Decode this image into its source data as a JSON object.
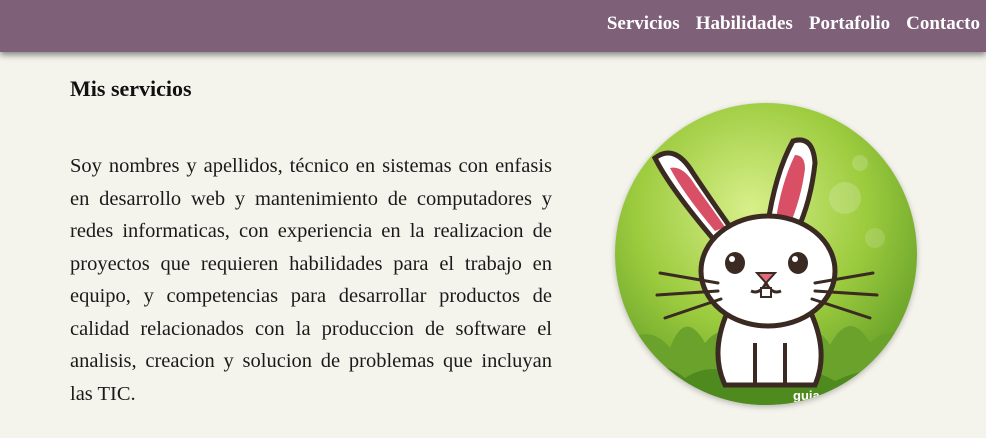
{
  "nav": {
    "items": [
      "Servicios",
      "Habilidades",
      "Portafolio",
      "Contacto"
    ]
  },
  "services": {
    "title": "Mis servicios",
    "description": "Soy nombres y apellidos, técnico en sistemas con enfasis en desarrollo web y mantenimiento de computadores y redes informaticas, con experiencia en la realizacion de proyectos que requieren habilidades para el trabajo en equipo, y competencias para desarrollar productos de calidad relacionados con la produccion de software el analisis, creacion y solucion de problemas que incluyan las TIC."
  },
  "avatar": {
    "icon": "rabbit-illustration",
    "watermark": "guia"
  },
  "colors": {
    "nav_bg": "#7e6079",
    "page_bg": "#f4f3ec",
    "nav_text": "#ffffff"
  }
}
